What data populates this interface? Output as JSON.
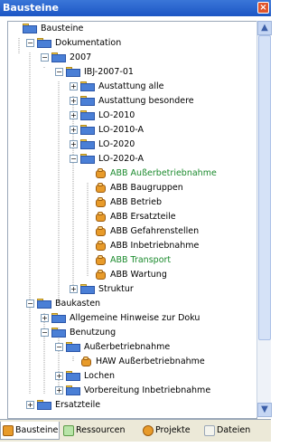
{
  "title": "Bausteine",
  "close_glyph": "×",
  "tree": [
    {
      "label": "Bausteine",
      "icon": "folder-icon",
      "expander": ""
    },
    {
      "label": "Dokumentation",
      "icon": "folder-icon",
      "expander": "−"
    },
    {
      "label": "2007",
      "icon": "folder-icon",
      "expander": "−"
    },
    {
      "label": "IBJ-2007-01",
      "icon": "folder-icon",
      "expander": "−"
    },
    {
      "label": "Austattung alle",
      "icon": "folder-icon",
      "expander": "+"
    },
    {
      "label": "Austattung besondere",
      "icon": "folder-icon",
      "expander": "+"
    },
    {
      "label": "LO-2010",
      "icon": "folder-icon",
      "expander": "+"
    },
    {
      "label": "LO-2010-A",
      "icon": "folder-icon",
      "expander": "+"
    },
    {
      "label": "LO-2020",
      "icon": "folder-icon",
      "expander": "+"
    },
    {
      "label": "LO-2020-A",
      "icon": "folder-icon",
      "expander": "−"
    },
    {
      "label": "ABB Außerbetriebnahme",
      "icon": "block-icon",
      "expander": "",
      "highlight": true
    },
    {
      "label": "ABB Baugruppen",
      "icon": "block-icon",
      "expander": ""
    },
    {
      "label": "ABB Betrieb",
      "icon": "block-icon",
      "expander": ""
    },
    {
      "label": "ABB Ersatzteile",
      "icon": "block-icon",
      "expander": ""
    },
    {
      "label": "ABB Gefahrenstellen",
      "icon": "block-icon",
      "expander": ""
    },
    {
      "label": "ABB Inbetriebnahme",
      "icon": "block-icon",
      "expander": ""
    },
    {
      "label": "ABB Transport",
      "icon": "block-icon",
      "expander": "",
      "highlight": true
    },
    {
      "label": "ABB Wartung",
      "icon": "block-icon",
      "expander": ""
    },
    {
      "label": "Struktur",
      "icon": "folder-icon",
      "expander": "+"
    },
    {
      "label": "Baukasten",
      "icon": "folder-icon",
      "expander": "−"
    },
    {
      "label": "Allgemeine Hinweise zur Doku",
      "icon": "folder-icon",
      "expander": "+"
    },
    {
      "label": "Benutzung",
      "icon": "folder-icon",
      "expander": "−"
    },
    {
      "label": "Außerbetriebnahme",
      "icon": "folder-icon",
      "expander": "−"
    },
    {
      "label": "HAW Außerbetriebnahme",
      "icon": "block-icon",
      "expander": ""
    },
    {
      "label": "Lochen",
      "icon": "folder-icon",
      "expander": "+"
    },
    {
      "label": "Vorbereitung Inbetriebnahme",
      "icon": "folder-icon",
      "expander": "+"
    },
    {
      "label": "Ersatzteile",
      "icon": "folder-icon",
      "expander": "+"
    }
  ],
  "tabs": [
    {
      "label": "Bausteine",
      "active": true,
      "icon": "bausteine-icon"
    },
    {
      "label": "Ressourcen",
      "active": false,
      "icon": "ressourcen-icon"
    },
    {
      "label": "Projekte",
      "active": false,
      "icon": "projekte-icon"
    },
    {
      "label": "Dateien",
      "active": false,
      "icon": "dateien-icon"
    }
  ],
  "colors": {
    "titlebar": "#1c56c4",
    "highlight_text": "#1a8a2c",
    "folder": "#4a7fd6",
    "block": "#e89b2a"
  }
}
